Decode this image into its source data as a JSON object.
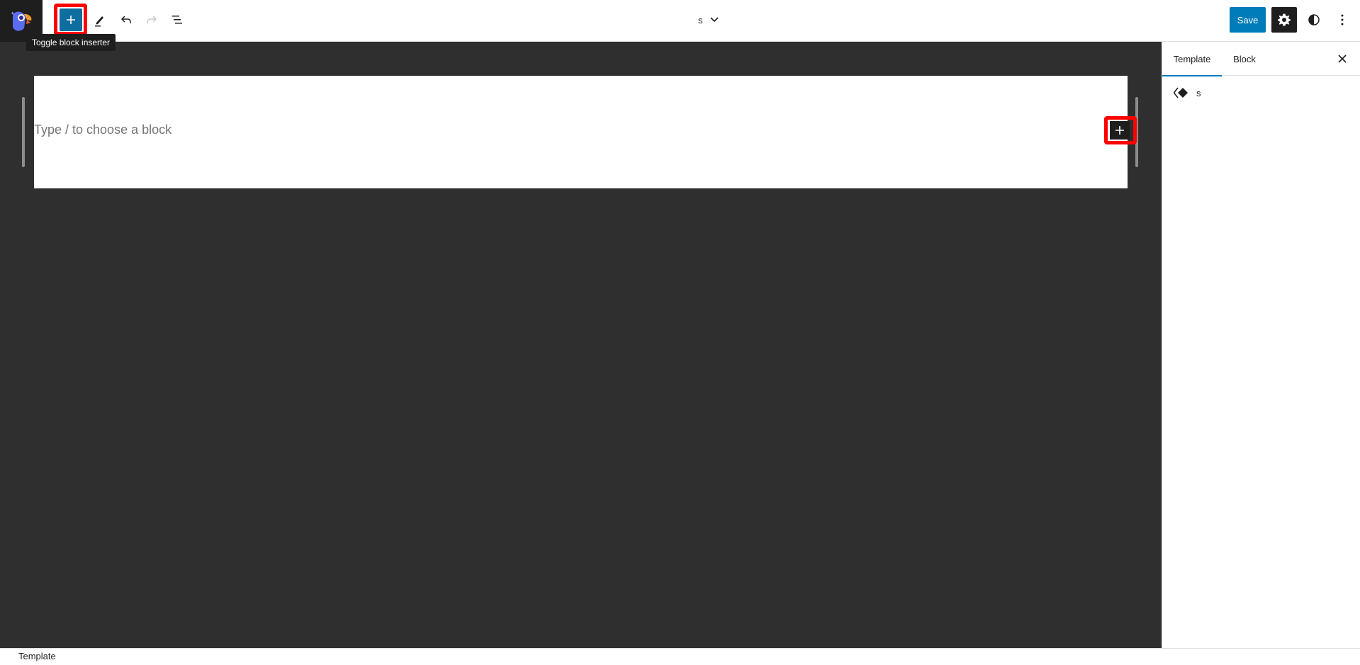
{
  "header": {
    "logo_alt": "Site logo",
    "inserter_tooltip": "Toggle block inserter",
    "icons": {
      "inserter": "plus-icon",
      "tools": "pencil-icon",
      "undo": "undo-icon",
      "redo": "redo-icon",
      "list_view": "list-view-icon"
    },
    "document_title": "s",
    "save_label": "Save",
    "settings_icon": "gear-icon",
    "styles_icon": "half-circle-icon",
    "more_icon": "vertical-ellipsis-icon"
  },
  "canvas": {
    "placeholder": "Type / to choose a block",
    "add_block_icon": "plus-icon"
  },
  "sidebar": {
    "tabs": [
      {
        "label": "Template",
        "active": true
      },
      {
        "label": "Block",
        "active": false
      }
    ],
    "close_icon": "close-icon",
    "template_name": "s",
    "template_icon": "layout-diamond-icon"
  },
  "footer": {
    "breadcrumb": "Template"
  },
  "colors": {
    "accent": "#007cba",
    "inserter_bg": "#0f6ea0",
    "highlight": "#ff0000",
    "canvas_bg": "#2f2f2f",
    "dark": "#1e1e1e"
  }
}
